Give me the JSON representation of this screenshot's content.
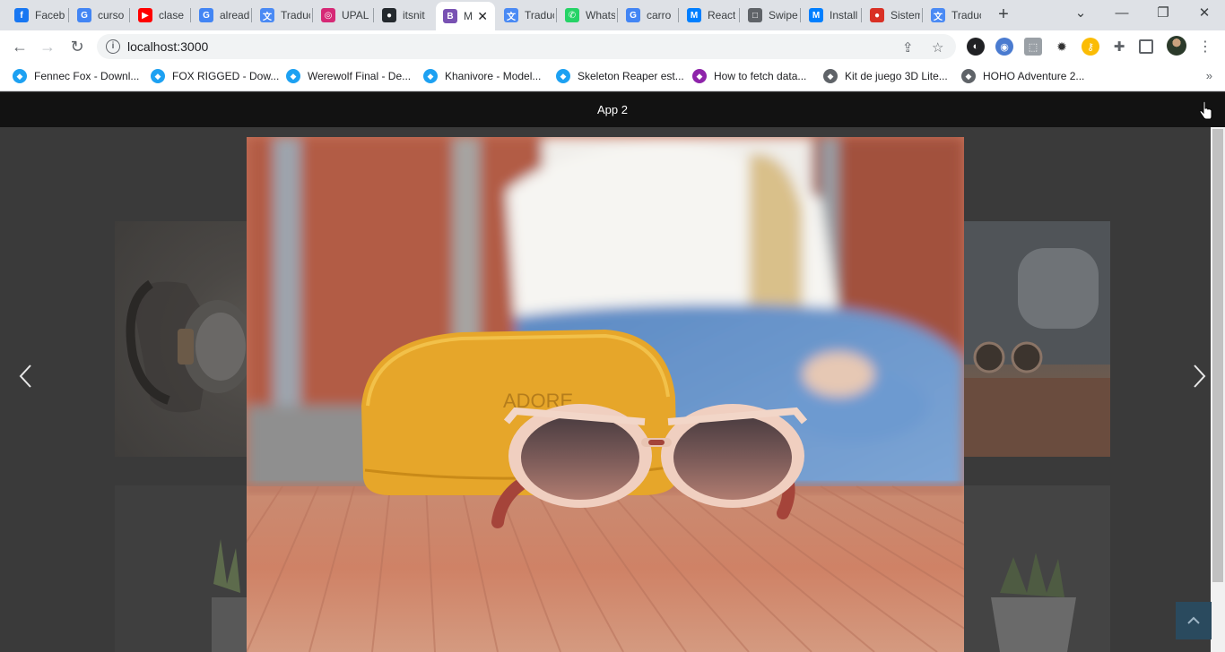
{
  "browser": {
    "tabs": [
      {
        "title": "Facebook",
        "icon": "facebook-icon",
        "color": "#1877f2",
        "glyph": "f"
      },
      {
        "title": "curso",
        "icon": "google-icon",
        "color": "#4285f4",
        "glyph": "G"
      },
      {
        "title": "clase",
        "icon": "youtube-icon",
        "color": "#ff0000",
        "glyph": "▶"
      },
      {
        "title": "already",
        "icon": "google-icon",
        "color": "#4285f4",
        "glyph": "G"
      },
      {
        "title": "Traducir",
        "icon": "translate-icon",
        "color": "#4a8af4",
        "glyph": "文"
      },
      {
        "title": "UPAL",
        "icon": "instagram-icon",
        "color": "#d62976",
        "glyph": "◎"
      },
      {
        "title": "itsnit",
        "icon": "github-icon",
        "color": "#24292e",
        "glyph": "●"
      },
      {
        "title": "M",
        "icon": "bootstrap-icon",
        "color": "#7952b3",
        "glyph": "B"
      },
      {
        "title": "Traducir",
        "icon": "translate-icon",
        "color": "#4a8af4",
        "glyph": "文"
      },
      {
        "title": "WhatsApp",
        "icon": "whatsapp-icon",
        "color": "#25d366",
        "glyph": "✆"
      },
      {
        "title": "carro",
        "icon": "google-icon",
        "color": "#4285f4",
        "glyph": "G"
      },
      {
        "title": "React",
        "icon": "mui-icon",
        "color": "#007fff",
        "glyph": "M"
      },
      {
        "title": "Swiper",
        "icon": "page-icon",
        "color": "#5f6368",
        "glyph": "□"
      },
      {
        "title": "Install",
        "icon": "mui-icon",
        "color": "#007fff",
        "glyph": "M"
      },
      {
        "title": "Sistema",
        "icon": "sistema-icon",
        "color": "#d93025",
        "glyph": "●"
      },
      {
        "title": "Traducir",
        "icon": "translate-icon",
        "color": "#4a8af4",
        "glyph": "文"
      }
    ],
    "active_tab_index": 7,
    "address": "localhost:3000",
    "bookmarks": [
      {
        "label": "Fennec Fox - Downl...",
        "color": "#1da1f2"
      },
      {
        "label": "FOX RIGGED - Dow...",
        "color": "#1da1f2"
      },
      {
        "label": "Werewolf Final - De...",
        "color": "#1da1f2"
      },
      {
        "label": "Khanivore - Model...",
        "color": "#1da1f2"
      },
      {
        "label": "Skeleton Reaper est...",
        "color": "#1da1f2"
      },
      {
        "label": "How to fetch data...",
        "color": "#8e24aa"
      },
      {
        "label": "Kit de juego 3D Lite...",
        "color": "#5f6368"
      },
      {
        "label": "HOHO Adventure 2...",
        "color": "#5f6368"
      }
    ]
  },
  "app": {
    "title": "App 2",
    "colors": {
      "header": "#121212",
      "background": "#3a3a3a"
    }
  },
  "carousel": {
    "prev_icon": "chevron-left-icon",
    "next_icon": "chevron-right-icon",
    "active_slide": "sunglasses-on-yellow-case",
    "case_brand": "ADORE"
  }
}
